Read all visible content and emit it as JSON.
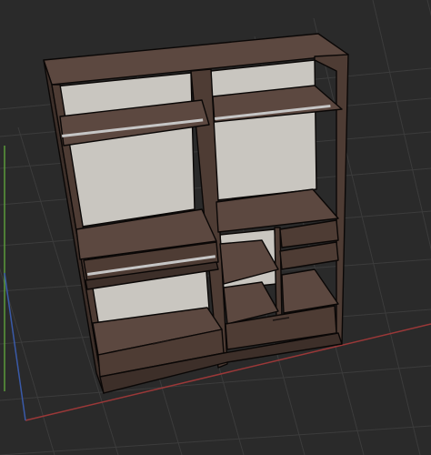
{
  "viewport": {
    "view": "3D viewport",
    "background_color": "#2a2a2a",
    "grid_color": "#3c3c3c",
    "x_axis_color": "#9a3838",
    "y_axis_color": "#5a9a3a",
    "z_axis_color": "#3a5aa8"
  },
  "model": {
    "object": "wardrobe",
    "wood_color": "#4e3c34",
    "wood_top_color": "#5c4840",
    "back_panel_color": "#c9c6c0",
    "outline_color": "#0a0706",
    "rail_color": "#c6c6c6"
  }
}
